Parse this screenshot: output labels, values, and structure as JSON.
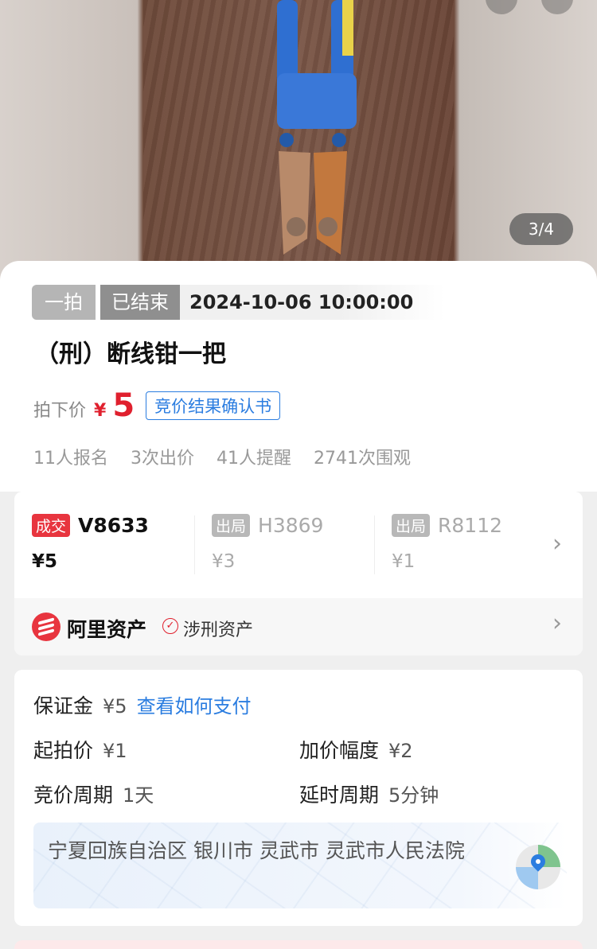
{
  "photo": {
    "counter": "3/4"
  },
  "auction": {
    "round_tag": "一拍",
    "status_tag": "已结束",
    "end_time": "2024-10-06 10:00:00",
    "title": "（刑）断线钳一把",
    "price_label": "拍下价",
    "currency": "¥",
    "price": "5",
    "confirm_label": "竞价结果确认书",
    "stats": [
      "11人报名",
      "3次出价",
      "41人提醒",
      "2741次围观"
    ]
  },
  "bids": [
    {
      "tag": "成交",
      "name": "V8633",
      "price": "¥5"
    },
    {
      "tag": "出局",
      "name": "H3869",
      "price": "¥3"
    },
    {
      "tag": "出局",
      "name": "R8112",
      "price": "¥1"
    }
  ],
  "platform": {
    "name": "阿里资产",
    "tag": "涉刑资产"
  },
  "info": {
    "deposit_label": "保证金",
    "deposit_value": "¥5",
    "pay_link": "查看如何支付",
    "start_label": "起拍价",
    "start_value": "¥1",
    "increment_label": "加价幅度",
    "increment_value": "¥2",
    "period_label": "竞价周期",
    "period_value": "1天",
    "delay_label": "延时周期",
    "delay_value": "5分钟",
    "address": "宁夏回族自治区 银川市 灵武市 灵武市人民法院"
  },
  "colors": {
    "accent_red": "#e0202e",
    "link_blue": "#2b7de0"
  }
}
